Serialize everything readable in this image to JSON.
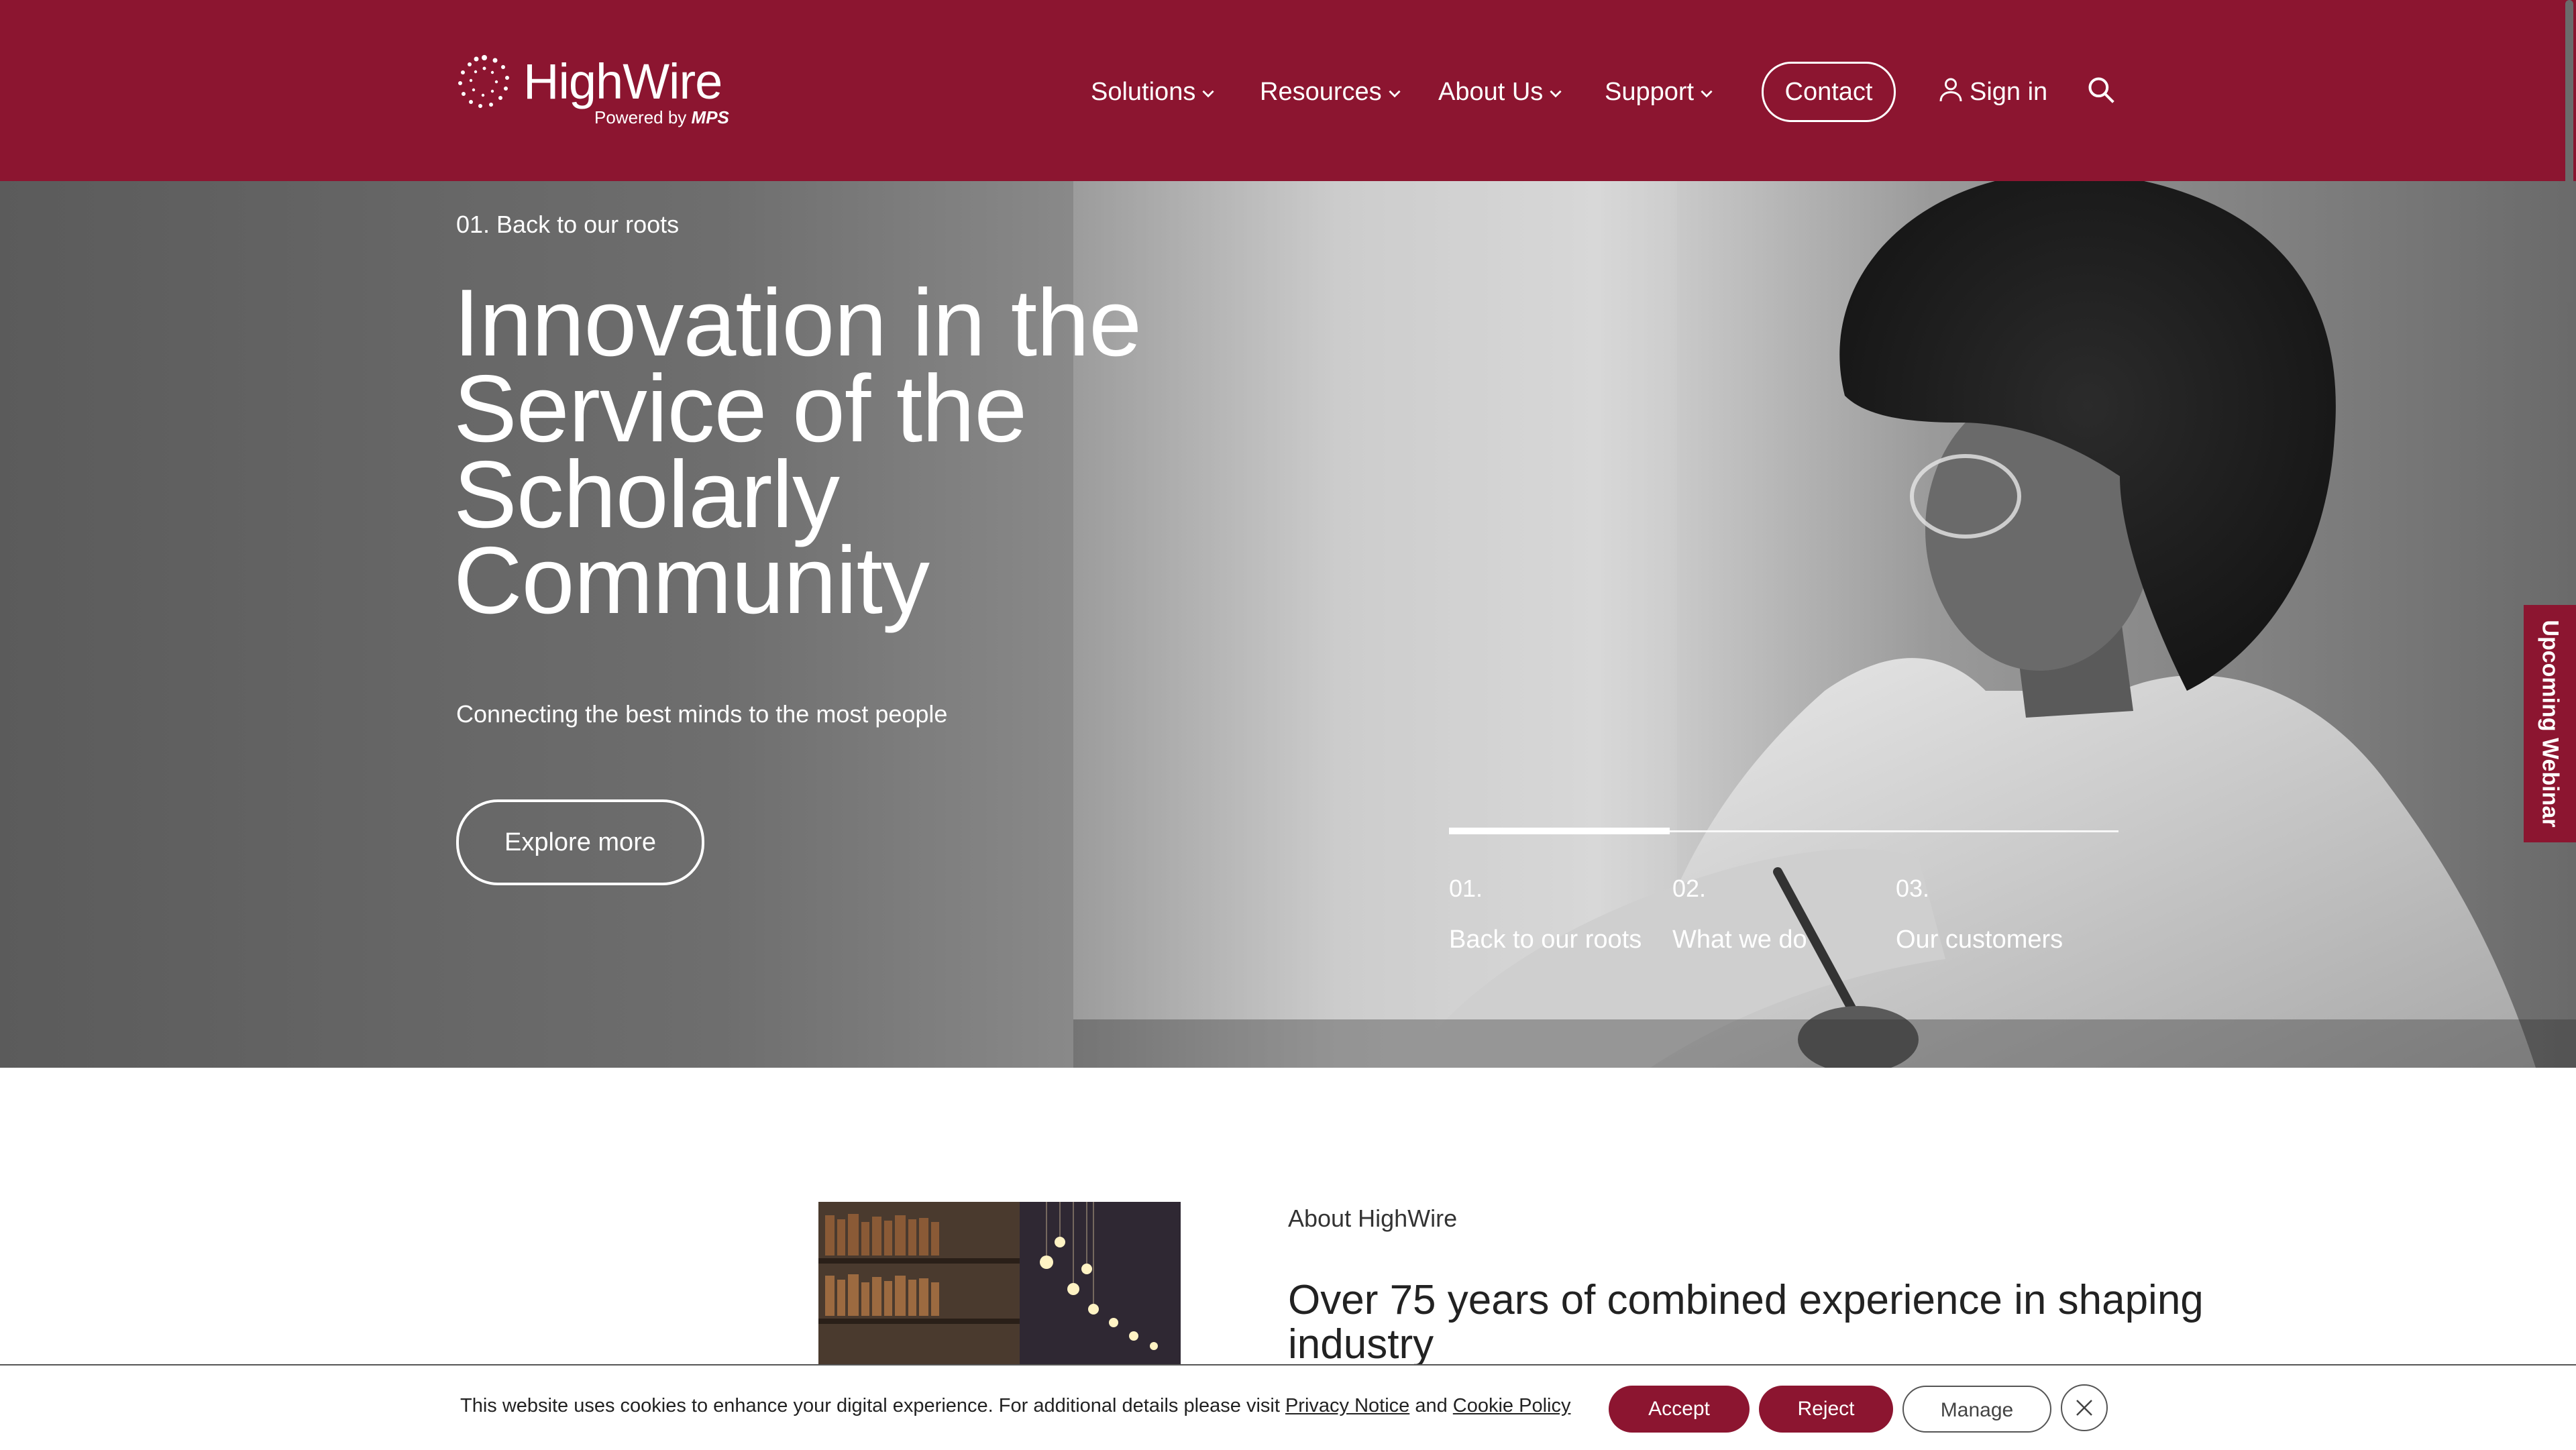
{
  "brand": {
    "logo_text": "HighWire",
    "logo_sub_prefix": "Powered by ",
    "logo_sub_brand": "MPS",
    "primary_color": "#8c1530"
  },
  "nav": {
    "items": [
      {
        "label": "Solutions",
        "icon": "chevron-down-icon"
      },
      {
        "label": "Resources",
        "icon": "chevron-down-icon"
      },
      {
        "label": "About Us",
        "icon": "chevron-down-icon"
      },
      {
        "label": "Support",
        "icon": "chevron-down-icon"
      }
    ],
    "contact_label": "Contact",
    "signin_label": "Sign in",
    "signin_icon": "user-icon",
    "search_icon": "search-icon"
  },
  "hero": {
    "eyebrow": "01. Back to our roots",
    "title": "Innovation in the Service of the Scholarly Community",
    "subtitle": "Connecting the best minds to the most people",
    "cta_label": "Explore more",
    "slides": [
      {
        "num": "01.",
        "label": "Back to our roots"
      },
      {
        "num": "02.",
        "label": "What we do"
      },
      {
        "num": "03.",
        "label": "Our customers"
      }
    ],
    "active_slide_progress": 0.33
  },
  "side_tab": {
    "label": "Upcoming Webinar"
  },
  "about": {
    "eyebrow": "About HighWire",
    "title": "Over 75 years of combined experience in shaping industry"
  },
  "cookie": {
    "text_prefix": "This website uses cookies to enhance your digital experience. For additional details please visit ",
    "privacy_link": "Privacy Notice",
    "and_text": " and ",
    "cookie_link": "Cookie Policy",
    "accept_label": "Accept",
    "reject_label": "Reject",
    "manage_label": "Manage",
    "close_icon": "close-icon"
  }
}
